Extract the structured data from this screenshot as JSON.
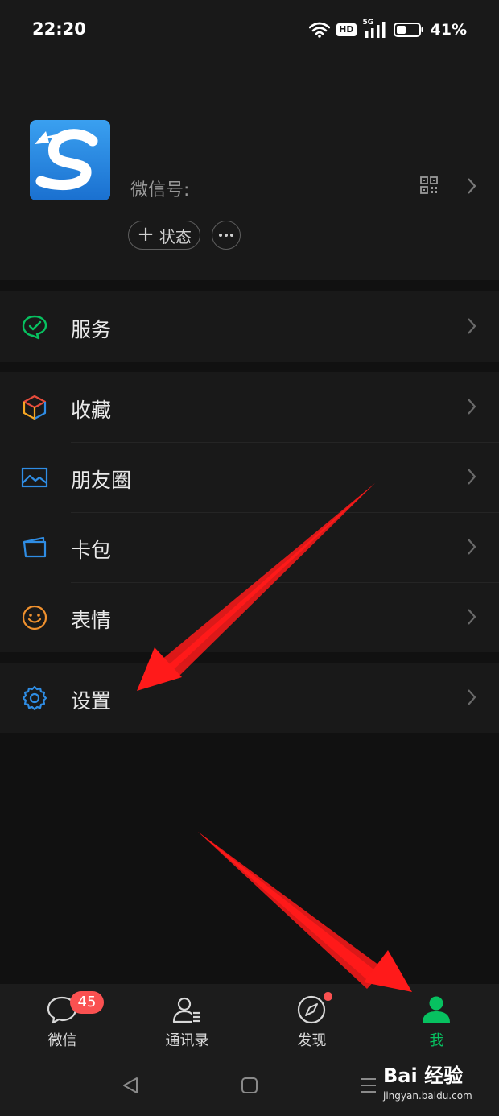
{
  "status_bar": {
    "time": "22:20",
    "hd": "HD",
    "network": "5G",
    "battery": "41%"
  },
  "profile": {
    "wechat_id_label": "微信号:",
    "status_button": "状态",
    "status_plus": "+"
  },
  "menu": {
    "services": "服务",
    "favorites": "收藏",
    "moments": "朋友圈",
    "cards": "卡包",
    "stickers": "表情",
    "settings": "设置"
  },
  "tabs": {
    "chats": "微信",
    "chats_badge": "45",
    "contacts": "通讯录",
    "discover": "发现",
    "me": "我"
  },
  "watermark": {
    "line1": "Bai 经验",
    "line2": "jingyan.baidu.com"
  },
  "colors": {
    "accent": "#07c160",
    "badge": "#fa5151",
    "annotation_arrow": "#ff1a1a"
  }
}
